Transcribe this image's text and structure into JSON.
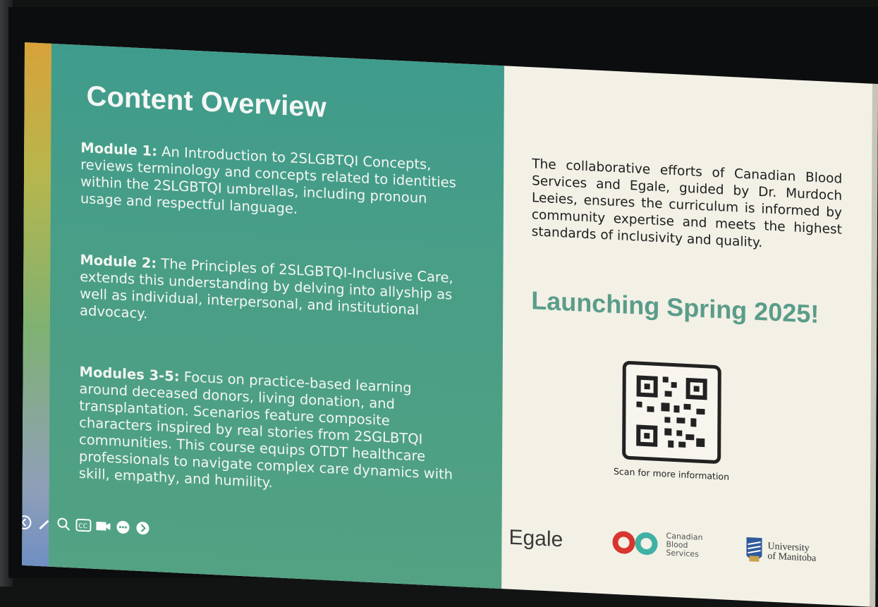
{
  "slide": {
    "title": "Content Overview",
    "modules": [
      {
        "label": "Module 1:",
        "text": " An Introduction to 2SLGBTQI Concepts, reviews terminology and concepts related to identities within the 2SLGBTQI umbrellas, including pronoun usage and respectful language."
      },
      {
        "label": "Module 2:",
        "text": " The Principles of 2SLGBTQI-Inclusive Care, extends this understanding by delving into allyship as well as individual, interpersonal, and institutional advocacy."
      },
      {
        "label": "Modules 3-5:",
        "text": " Focus on practice-based learning around deceased donors, living donation, and transplantation. Scenarios feature composite characters inspired by real stories from 2SGLBTQI communities. This course equips OTDT healthcare professionals to navigate complex care dynamics with skill, empathy, and humility."
      }
    ],
    "collab_text": "The collaborative efforts of Canadian Blood Services and Egale, guided by Dr. Murdoch Leeies, ensures the curriculum is informed by community expertise and meets the highest standards of inclusivity and quality.",
    "launch_text": "Launching Spring 2025!",
    "qr_caption": "Scan for more information",
    "logos": {
      "egale": "Egale",
      "cbs_line1": "Canadian",
      "cbs_line2": "Blood",
      "cbs_line3": "Services",
      "um_line1": "University",
      "um_line2": "of Manitoba"
    }
  },
  "toolbar": {
    "icons": [
      "back-arrow-icon",
      "pen-icon",
      "zoom-icon",
      "captions-icon",
      "camera-icon",
      "more-icon",
      "forward-arrow-icon"
    ]
  },
  "colors": {
    "teal_panel": "#4a9e86",
    "launch_green": "#5a9c8a",
    "cream": "#f3f0e6",
    "cbs_red": "#d9352f",
    "cbs_teal": "#3fb0a4"
  }
}
